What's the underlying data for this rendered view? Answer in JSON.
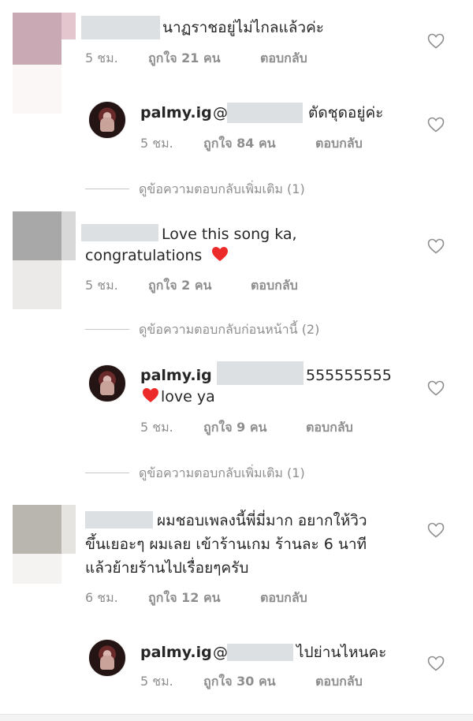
{
  "comments": [
    {
      "text": "นาฏราชอยู่ไม่ไกลแล้วค่ะ",
      "time": "5 ชม.",
      "likes": "ถูกใจ 21 คน",
      "reply": "ตอบกลับ"
    },
    {
      "username": "palmy.ig",
      "mention": "@",
      "text": "ตัดชุดอยู่ค่ะ",
      "time": "5 ชม.",
      "likes": "ถูกใจ 84 คน",
      "reply": "ตอบกลับ",
      "view_more": "ดูข้อความตอบกลับเพิ่มเติม (1)"
    },
    {
      "text_line1": "Love this song ka,",
      "text_line2": "congratulations",
      "time": "5 ชม.",
      "likes": "ถูกใจ 2 คน",
      "reply": "ตอบกลับ",
      "view_prev": "ดูข้อความตอบกลับก่อนหน้านี้ (2)"
    },
    {
      "username": "palmy.ig",
      "text_line1": "555555555",
      "text_line2": "love ya",
      "time": "5 ชม.",
      "likes": "ถูกใจ 9 คน",
      "reply": "ตอบกลับ",
      "view_more": "ดูข้อความตอบกลับเพิ่มเติม (1)"
    },
    {
      "text_line1": "ผมชอบเพลงนี้พี่มี่มาก อยากให้วิว",
      "text_line2": "ขึ้นเยอะๆ ผมเลย เข้าร้านเกม ร้านละ 6 นาที",
      "text_line3": "แล้วย้ายร้านไปเรื่อยๆครับ",
      "time": "6 ชม.",
      "likes": "ถูกใจ 12 คน",
      "reply": "ตอบกลับ"
    },
    {
      "username": "palmy.ig",
      "mention": "@",
      "text": "ไปย่านไหนคะ",
      "time": "5 ชม.",
      "likes": "ถูกใจ 30 คน",
      "reply": "ตอบกลับ"
    }
  ],
  "colors": {
    "text": "#262626",
    "meta": "#8e8e8e",
    "heart_red": "#ed2a2a"
  },
  "icons": {
    "like": "heart-outline-icon",
    "emoji": "red-heart-emoji"
  }
}
